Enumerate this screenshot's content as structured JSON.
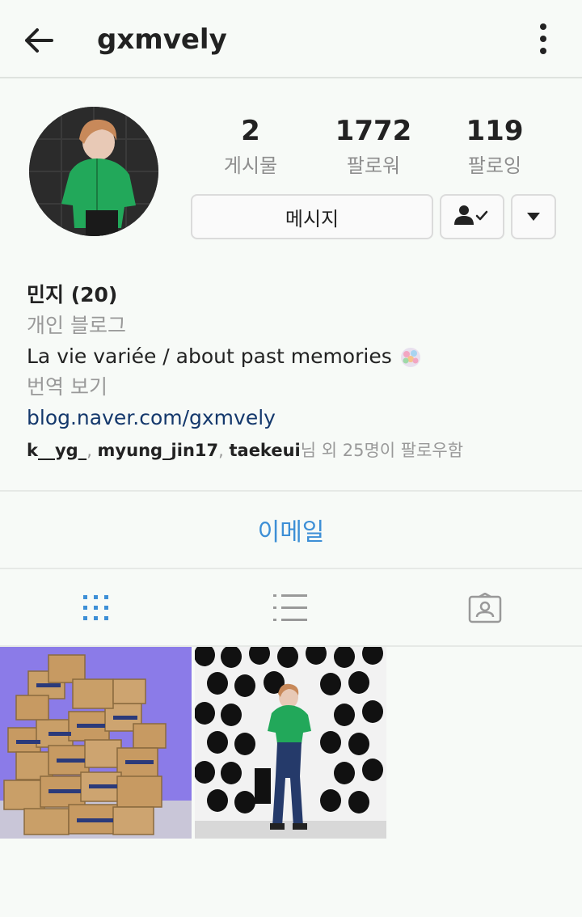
{
  "header": {
    "username": "gxmvely",
    "back_icon": "arrow-left-icon",
    "menu_icon": "more-vertical-icon"
  },
  "stats": {
    "posts": {
      "value": "2",
      "label": "게시물"
    },
    "followers": {
      "value": "1772",
      "label": "팔로워"
    },
    "following": {
      "value": "119",
      "label": "팔로잉"
    }
  },
  "actions": {
    "message_label": "메시지",
    "following_icon": "person-check-icon",
    "more_icon": "triangle-down-icon"
  },
  "bio": {
    "name": "민지 (20)",
    "category": "개인 블로그",
    "description": "La vie variée / about past memories",
    "description_emoji": "bouquet-icon",
    "translate": "번역 보기",
    "website": "blog.naver.com/gxmvely",
    "followed_by_user1": "k__yg_",
    "followed_by_sep1": ", ",
    "followed_by_user2": "myung_jin17",
    "followed_by_sep2": ", ",
    "followed_by_user3": "taekeui",
    "followed_by_suffix": "님 외 25명이 팔로우함"
  },
  "contact": {
    "email_label": "이메일"
  },
  "tabs": [
    {
      "icon": "grid-icon",
      "active": true
    },
    {
      "icon": "list-icon",
      "active": false
    },
    {
      "icon": "tagged-icon",
      "active": false
    }
  ],
  "colors": {
    "accent": "#3d8fd6",
    "link": "#14386c",
    "muted": "#999999",
    "background": "#f7faf7"
  }
}
